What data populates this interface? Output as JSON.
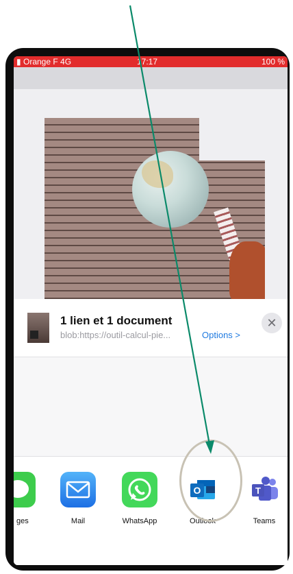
{
  "status_bar": {
    "carrier": "Orange F  4G",
    "time": "17:17",
    "battery": "100 %"
  },
  "share_sheet": {
    "title": "1 lien et 1 document",
    "url": "blob:https://outil-calcul-pie...",
    "options_label": "Options >",
    "close_label": "✕"
  },
  "apps": [
    {
      "label": "ges",
      "icon": "messages-icon"
    },
    {
      "label": "Mail",
      "icon": "mail-icon"
    },
    {
      "label": "WhatsApp",
      "icon": "whatsapp-icon"
    },
    {
      "label": "Outlook",
      "icon": "outlook-icon"
    },
    {
      "label": "Teams",
      "icon": "teams-icon"
    }
  ],
  "annotation": {
    "arrow_color": "#0b8a6a",
    "highlight_color": "#c8c2b4"
  },
  "colors": {
    "status_bar": "#e22c2c",
    "link": "#1f7ae0"
  }
}
